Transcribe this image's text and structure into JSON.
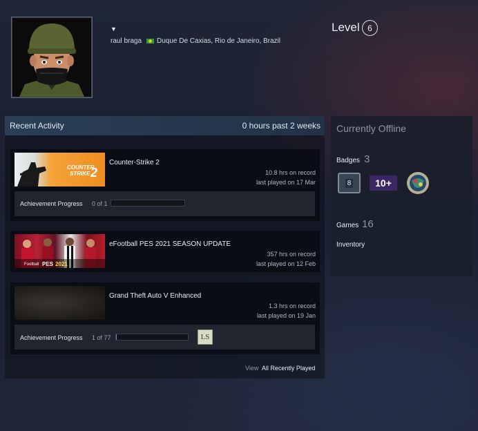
{
  "profile": {
    "persona_caret": "▼",
    "real_name": "raul braga",
    "location": "Duque De Caxias, Rio de Janeiro, Brazil",
    "level_label": "Level",
    "level_value": "6"
  },
  "activity": {
    "title": "Recent Activity",
    "hours_summary": "0 hours past 2 weeks",
    "games": [
      {
        "name": "Counter-Strike 2",
        "capsule_text": "COUNTER STRIKE 2",
        "hours": "10.8 hrs on record",
        "last_played": "last played on 17 Mar",
        "achievement_label": "Achievement Progress",
        "achievement_count": "0 of 1",
        "achievement_fraction": 0
      },
      {
        "name": "eFootball PES 2021 SEASON UPDATE",
        "capsule_text": "Football PES 2021",
        "hours": "357 hrs on record",
        "last_played": "last played on 12 Feb"
      },
      {
        "name": "Grand Theft Auto V Enhanced",
        "hours": "1.3 hrs on record",
        "last_played": "last played on 19 Jan",
        "achievement_label": "Achievement Progress",
        "achievement_count": "1 of 77",
        "achievement_fraction": 0.013
      }
    ],
    "view_label": "View",
    "view_all_label": "All Recently Played"
  },
  "side": {
    "status": "Currently Offline",
    "badges_label": "Badges",
    "badges_count": "3",
    "badge_1_text": "8",
    "badge_2_text": "10+",
    "games_label": "Games",
    "games_count": "16",
    "inventory_label": "Inventory"
  },
  "colors": {
    "accent_header": "#2a3f57",
    "flag_green": "#2f9b3a",
    "cs2_orange": "#f08d1f"
  }
}
